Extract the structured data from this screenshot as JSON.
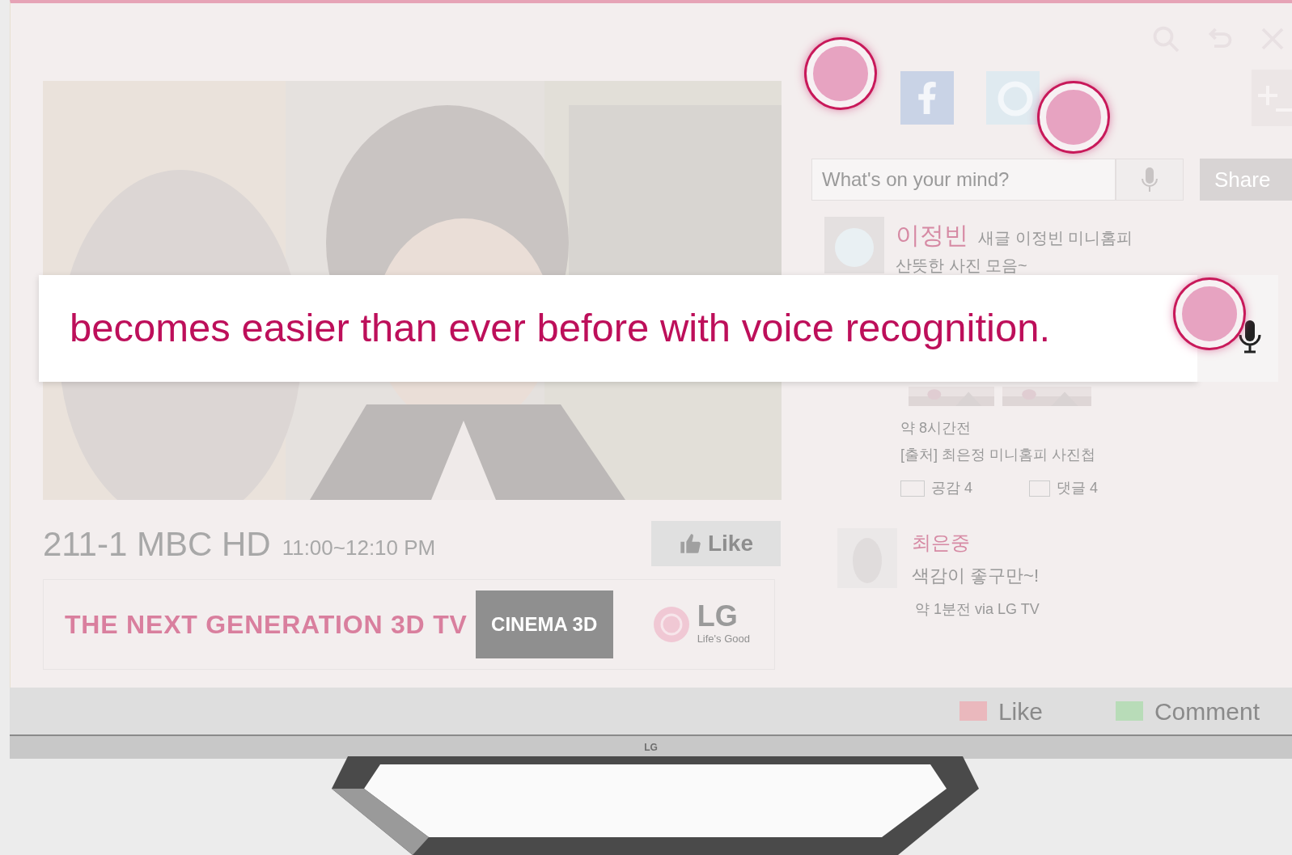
{
  "voice_banner": {
    "text": "becomes easier than ever before with voice recognition."
  },
  "channel": {
    "name": "211-1 MBC HD",
    "time": "11:00~12:10 PM",
    "like_button": "Like"
  },
  "ad_banner": {
    "headline": "THE NEXT GENERATION 3D TV",
    "product_logo": "CINEMA 3D",
    "brand": "LG",
    "slogan": "Life's Good"
  },
  "social": {
    "status_input": {
      "placeholder": "What's on your mind?"
    },
    "share_button": "Share"
  },
  "posts": [
    {
      "author": "이정빈",
      "headline": "새글 이정빈 미니홈피",
      "text": "산뜻한 사진 모음~",
      "time": "약 8시간전",
      "source": "[출처] 최은정 미니홈피 사진첩",
      "likes": "공감 4",
      "comments": "댓글 4"
    },
    {
      "author": "최은중",
      "text": "색감이 좋구만~!",
      "time": "약 1분전 via LG TV"
    }
  ],
  "bottom_bar": {
    "like": "Like",
    "comment": "Comment"
  },
  "tv": {
    "logo": "LG"
  }
}
